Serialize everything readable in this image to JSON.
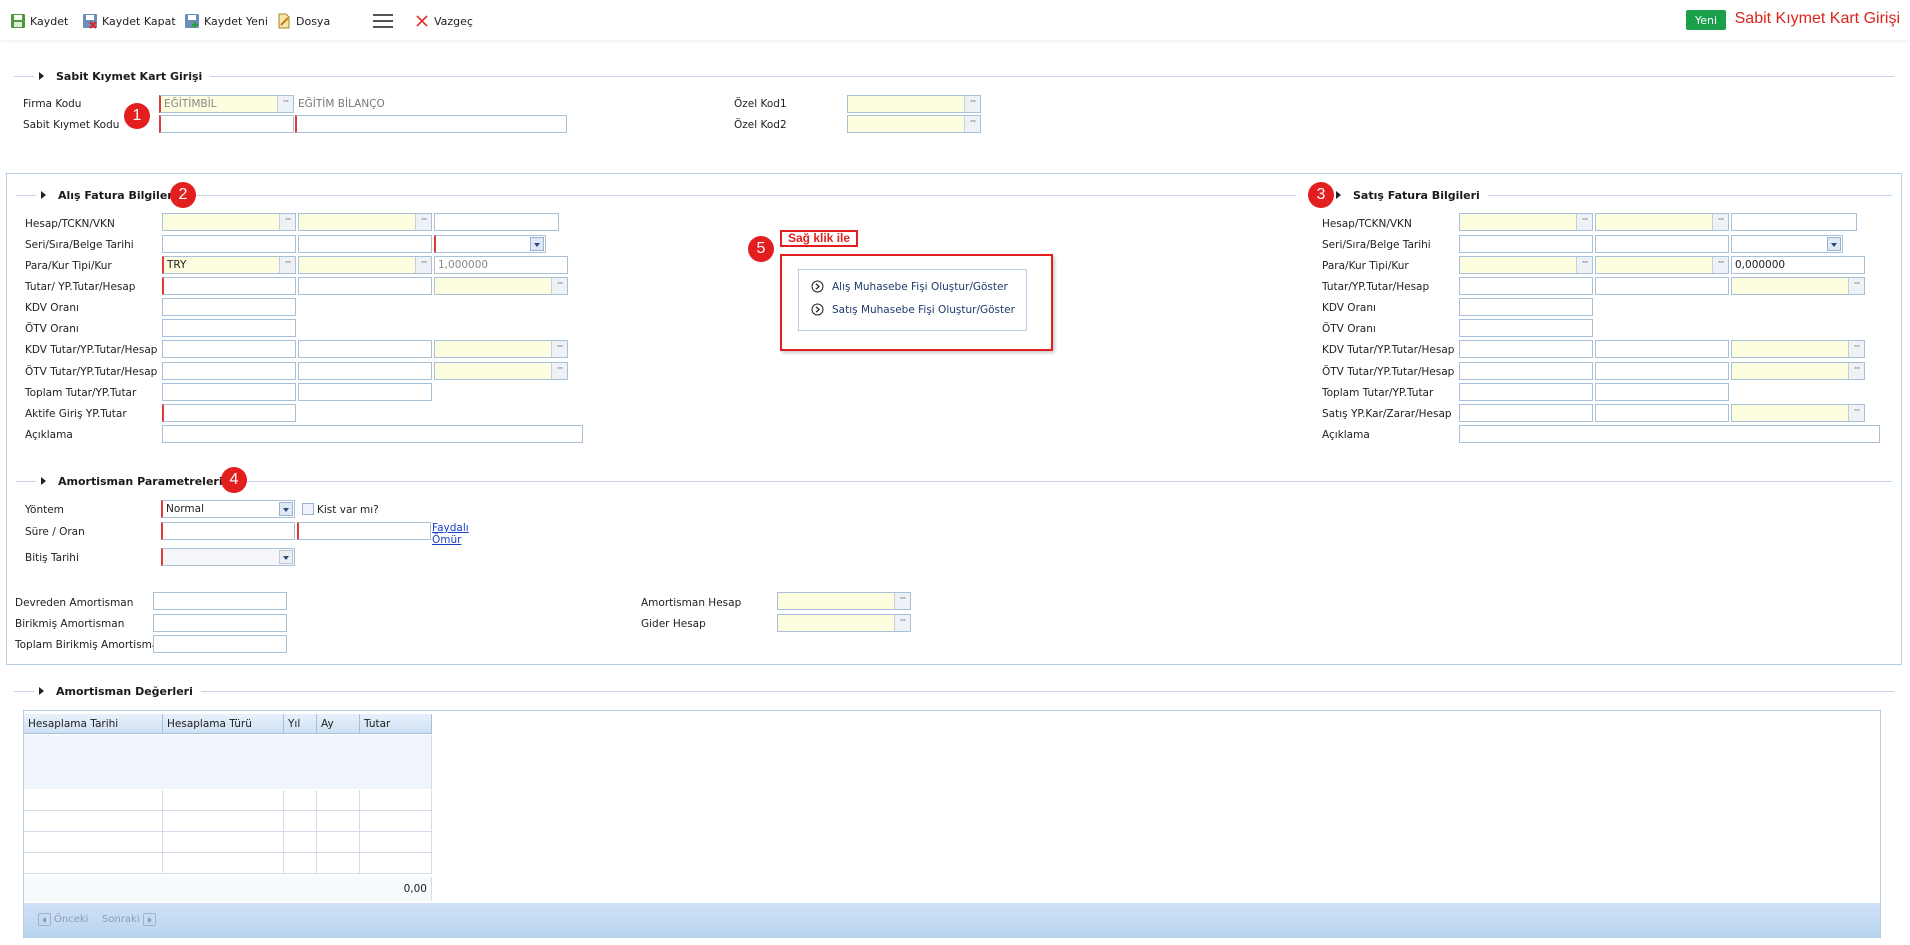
{
  "toolbar": {
    "save": "Kaydet",
    "save_close": "Kaydet Kapat",
    "save_new": "Kaydet Yeni",
    "file": "Dosya",
    "cancel": "Vazgeç",
    "new": "Yeni",
    "page_title": "Sabit Kıymet Kart Girişi"
  },
  "header_section": {
    "title": "Sabit Kıymet Kart Girişi",
    "firma_kodu_label": "Firma Kodu",
    "firma_kodu_value": "EĞİTİMBİL",
    "firma_kodu_desc": "EĞİTİM BİLANÇO",
    "sabit_kiymet_kodu_label": "Sabit Kıymet Kodu",
    "ozel_kod1_label": "Özel Kod1",
    "ozel_kod2_label": "Özel Kod2"
  },
  "alis": {
    "title": "Alış Fatura Bilgileri",
    "labels": [
      "Hesap/TCKN/VKN",
      "Seri/Sıra/Belge Tarihi",
      "Para/Kur Tipi/Kur",
      "Tutar/ YP.Tutar/Hesap",
      "KDV Oranı",
      "ÖTV Oranı",
      "KDV Tutar/YP.Tutar/Hesap",
      "ÖTV Tutar/YP.Tutar/Hesap",
      "Toplam Tutar/YP.Tutar",
      "Aktife Giriş YP.Tutar",
      "Açıklama"
    ],
    "currency": "TRY",
    "rate": "1,000000"
  },
  "satis": {
    "title": "Satış Fatura Bilgileri",
    "labels": [
      "Hesap/TCKN/VKN",
      "Seri/Sıra/Belge Tarihi",
      "Para/Kur Tipi/Kur",
      "Tutar/YP.Tutar/Hesap",
      "KDV Oranı",
      "ÖTV Oranı",
      "KDV Tutar/YP.Tutar/Hesap",
      "ÖTV Tutar/YP.Tutar/Hesap",
      "Toplam Tutar/YP.Tutar",
      "Satış YP.Kar/Zarar/Hesap",
      "Açıklama"
    ],
    "rate": "0,000000"
  },
  "annotation": {
    "badges": [
      "1",
      "2",
      "3",
      "4",
      "5"
    ],
    "right_click_label": "Sağ klik ile",
    "menu_items": [
      "Alış Muhasebe Fişi Oluştur/Göster",
      "Satış Muhasebe Fişi Oluştur/Göster"
    ],
    "accent": "#e31e1e"
  },
  "amortisman": {
    "title": "Amortisman Parametreleri",
    "yontem_label": "Yöntem",
    "yontem_value": "Normal",
    "kist_label": "Kist var mı?",
    "sure_label": "Süre / Oran",
    "faydali_omur_line1": "Faydalı",
    "faydali_omur_line2": "Ömür",
    "bitis_label": "Bitiş Tarihi",
    "devreden_label": "Devreden Amortisman",
    "birikmis_label": "Birikmiş Amortisman",
    "toplam_birikmis_label": "Toplam Birikmiş Amortisman",
    "amortisman_hesap_label": "Amortisman Hesap",
    "gider_hesap_label": "Gider Hesap"
  },
  "values_section": {
    "title": "Amortisman Değerleri",
    "columns": [
      "Hesaplama Tarihi",
      "Hesaplama Türü",
      "Yıl",
      "Ay",
      "Tutar"
    ],
    "total": "0,00",
    "prev": "Önceki",
    "next": "Sonraki"
  },
  "colors": {
    "brand_green": "#1aa04a",
    "title_red": "#d9241b",
    "required": "#e03a3a",
    "lookup_yellow": "#fdfde0"
  }
}
